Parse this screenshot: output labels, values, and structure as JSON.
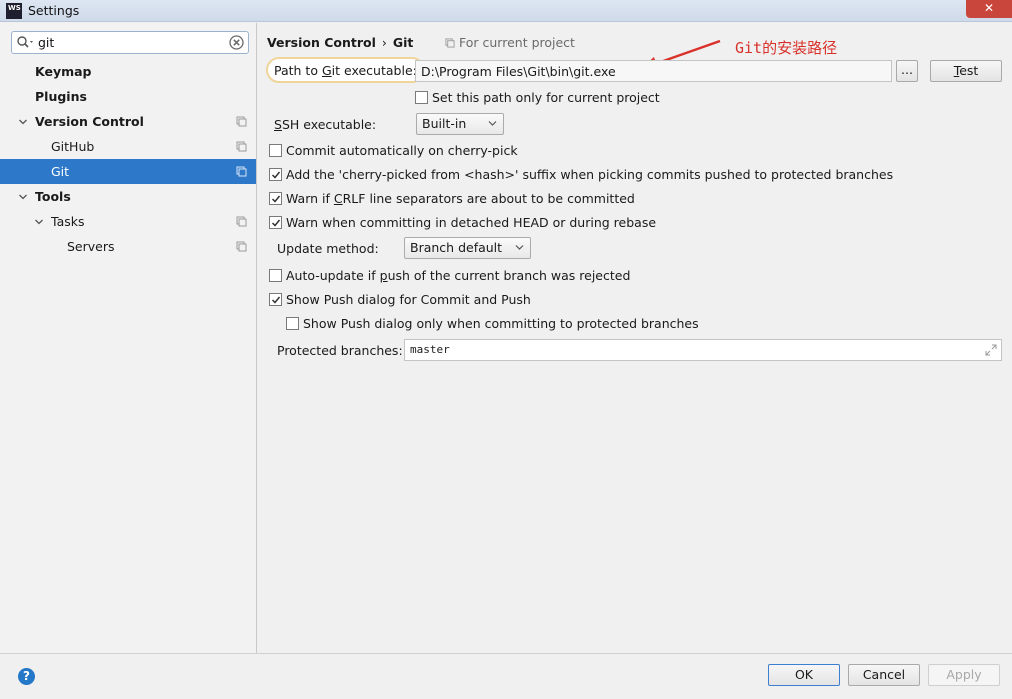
{
  "window": {
    "title": "Settings",
    "logo_text": "WS",
    "close_glyph": "✕"
  },
  "search": {
    "value": "git",
    "icon": "search-icon",
    "clear_icon": "clear-icon"
  },
  "sidebar": {
    "items": [
      {
        "label": "Keymap"
      },
      {
        "label": "Plugins"
      },
      {
        "label": "Version Control"
      },
      {
        "label": "GitHub"
      },
      {
        "label": "Git"
      },
      {
        "label": "Tools"
      },
      {
        "label": "Tasks"
      },
      {
        "label": "Servers"
      }
    ]
  },
  "breadcrumb": {
    "parent": "Version Control",
    "sep": "›",
    "current": "Git"
  },
  "for_project": "For current project",
  "annotation": "Git的安装路径",
  "git_path": {
    "label_pre": "Path to ",
    "label_u": "G",
    "label_post": "it executable:",
    "value": "D:\\Program Files\\Git\\bin\\git.exe",
    "browse": "...",
    "test_u": "T",
    "test_post": "est"
  },
  "options": {
    "path_current_project": {
      "label": "Set this path only for current project",
      "checked": false
    },
    "ssh_label_u": "S",
    "ssh_label_post": "SH executable:",
    "ssh_value": "Built-in",
    "cherry_pick": {
      "label": "Commit automatically on cherry-pick",
      "checked": false
    },
    "cherry_suffix": {
      "label": "Add the 'cherry-picked from <hash>' suffix when picking commits pushed to protected branches",
      "checked": true
    },
    "crlf_pre": "Warn if ",
    "crlf_u": "C",
    "crlf_post": "RLF line separators are about to be committed",
    "crlf_checked": true,
    "detached_head": {
      "label": "Warn when committing in detached HEAD or during rebase",
      "checked": true
    },
    "update_method_label": "Update method:",
    "update_method_value": "Branch default",
    "auto_update_pre": "Auto-update if ",
    "auto_update_u": "p",
    "auto_update_post": "ush of the current branch was rejected",
    "auto_update_checked": false,
    "push_dialog": {
      "label": "Show Push dialog for Commit and Push",
      "checked": true
    },
    "push_dialog_protected": {
      "label": "Show Push dialog only when committing to protected branches",
      "checked": false
    },
    "protected_label": "Protected branches:",
    "protected_value": "master"
  },
  "footer": {
    "help": "?",
    "ok": "OK",
    "cancel": "Cancel",
    "apply": "Apply"
  },
  "colors": {
    "accent": "#2d78c8",
    "annotation": "#d9322b",
    "highlight": "#efd59a"
  }
}
